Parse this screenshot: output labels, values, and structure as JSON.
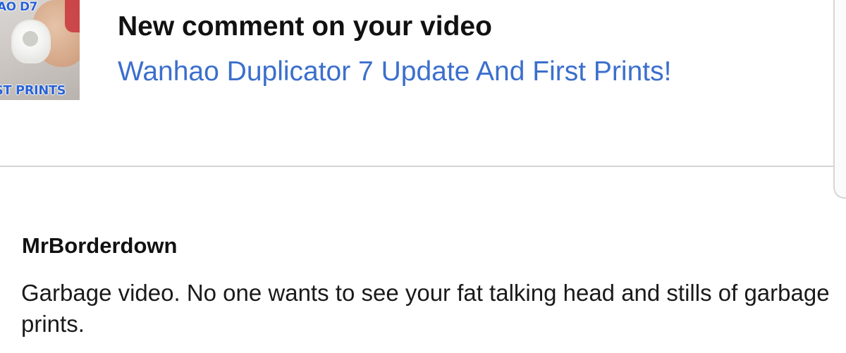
{
  "notification": {
    "title": "New comment on your video",
    "video_title": "Wanhao Duplicator 7 Update And First Prints!",
    "thumbnail": {
      "caption_top": "AO D7",
      "caption_bottom": "ST PRINTS"
    }
  },
  "comment": {
    "author": "MrBorderdown",
    "text": "Garbage video. No one wants to see your fat talking head and stills of garbage prints."
  },
  "colors": {
    "link": "#3b6fcc",
    "title": "#111111",
    "divider": "#d4d4d4"
  }
}
